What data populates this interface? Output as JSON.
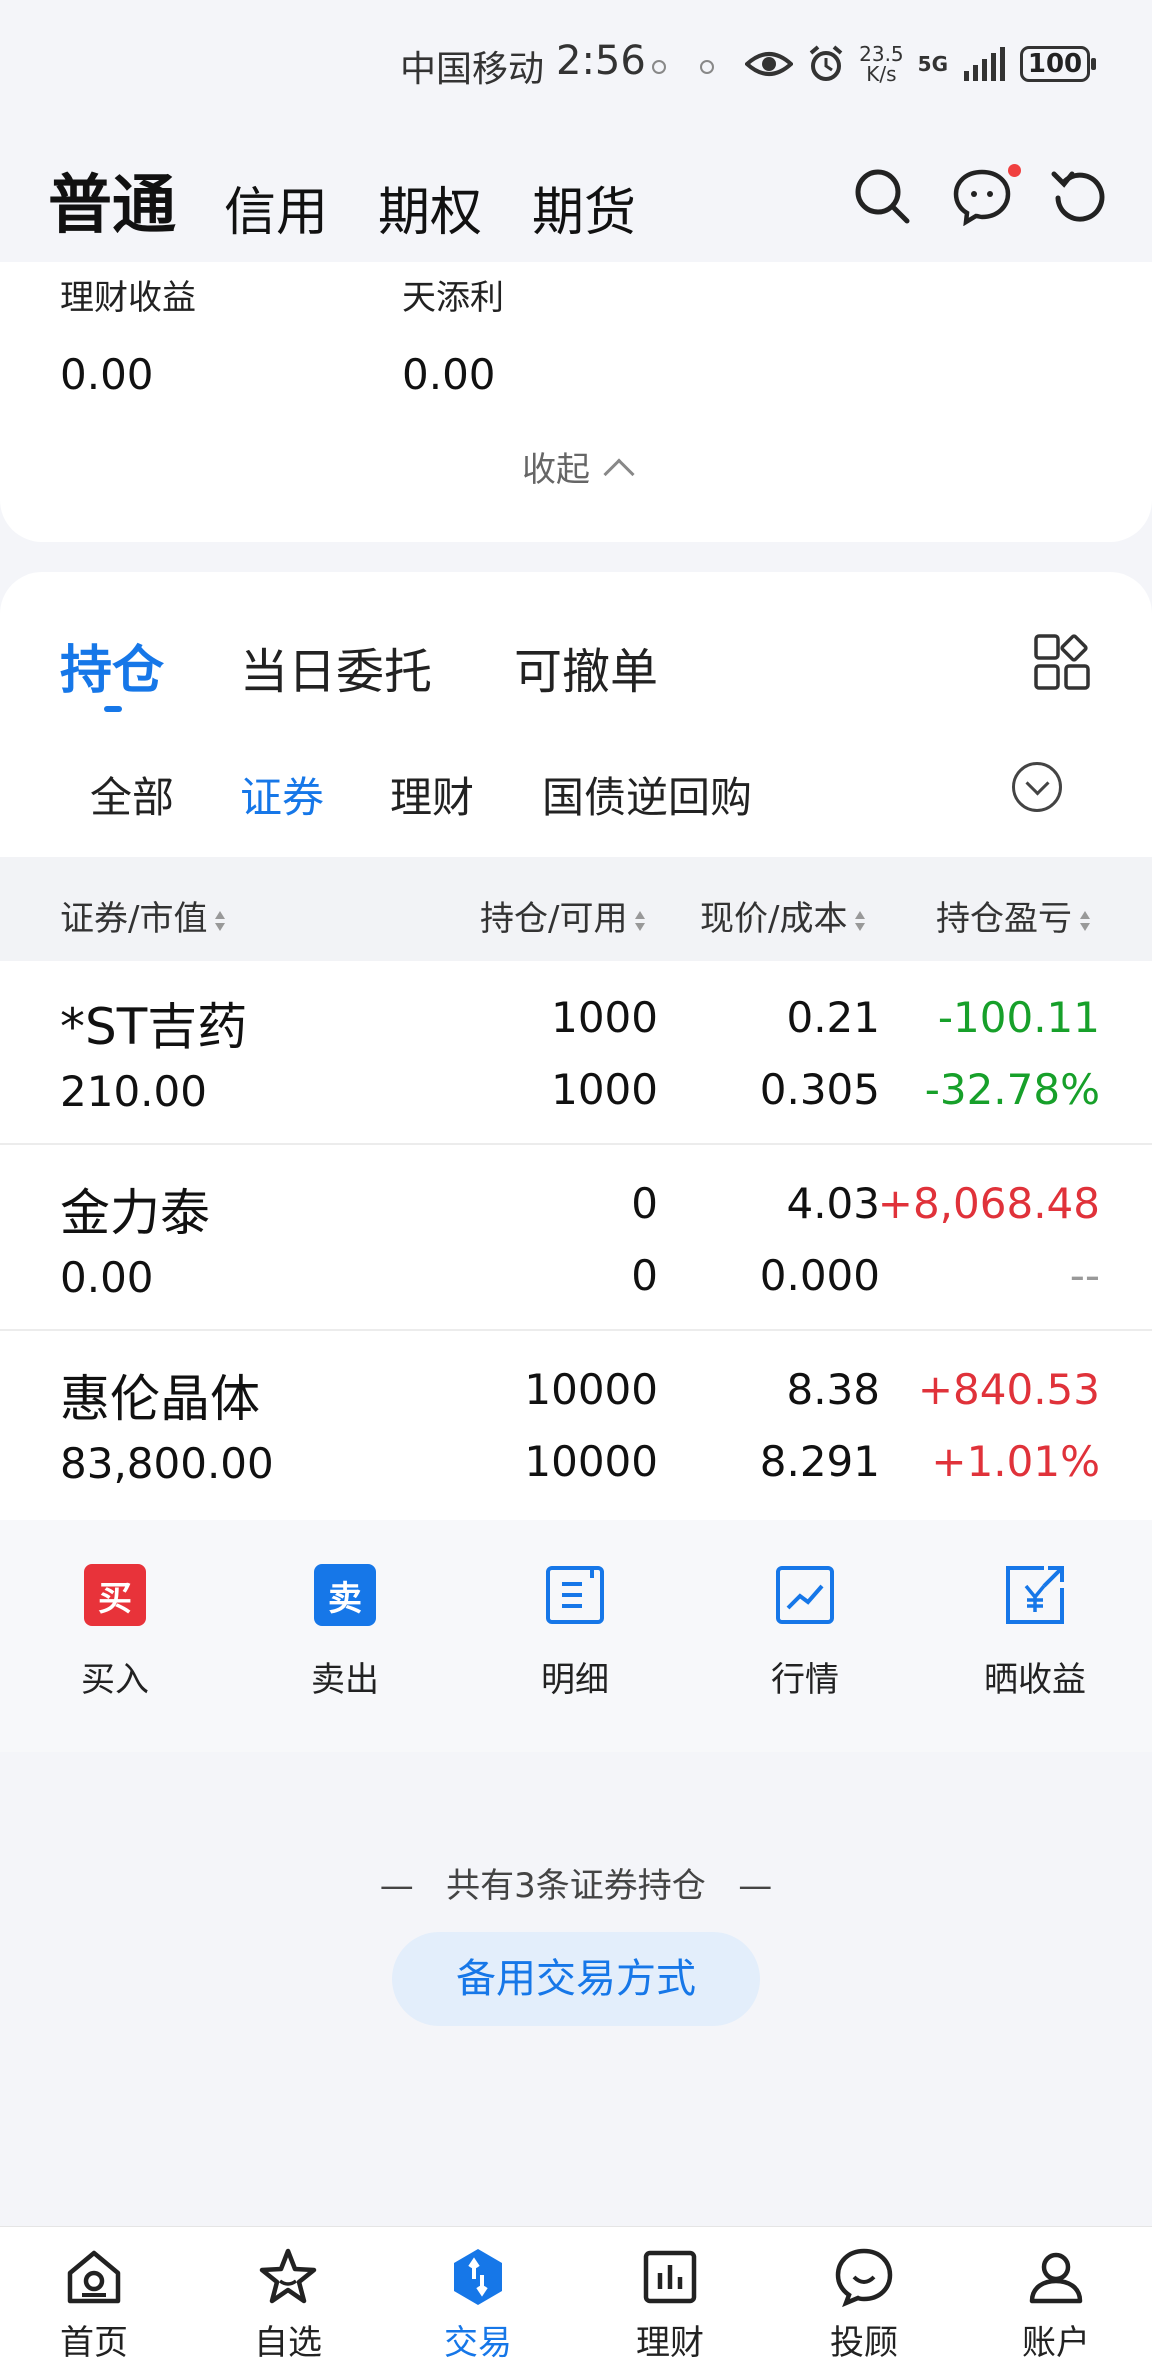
{
  "status_bar": {
    "carrier": "中国移动",
    "time": "2:56",
    "speed_value": "23.5",
    "speed_unit": "K/s",
    "network": "5G",
    "battery": "100"
  },
  "header": {
    "tabs": [
      "普通",
      "信用",
      "期权",
      "期货"
    ]
  },
  "summary": {
    "items": [
      {
        "label": "理财收益",
        "value": "0.00"
      },
      {
        "label": "天添利",
        "value": "0.00"
      }
    ],
    "collapse_label": "收起"
  },
  "positions": {
    "tabs": [
      "持仓",
      "当日委托",
      "可撤单"
    ],
    "sub_tabs": [
      "全部",
      "证券",
      "理财",
      "国债逆回购"
    ],
    "columns": [
      "证券/市值",
      "持仓/可用",
      "现价/成本",
      "持仓盈亏"
    ],
    "rows": [
      {
        "name": "*ST吉药",
        "market_value": "210.00",
        "holding": "1000",
        "available": "1000",
        "price": "0.21",
        "cost": "0.305",
        "pnl": "-100.11",
        "pnl_pct": "-32.78%"
      },
      {
        "name": "金力泰",
        "market_value": "0.00",
        "holding": "0",
        "available": "0",
        "price": "4.03",
        "cost": "0.000",
        "pnl": "+8,068.48",
        "pnl_pct": "--"
      },
      {
        "name": "惠伦晶体",
        "market_value": "83,800.00",
        "holding": "10000",
        "available": "10000",
        "price": "8.38",
        "cost": "8.291",
        "pnl": "+840.53",
        "pnl_pct": "+1.01%"
      }
    ]
  },
  "actions": [
    {
      "label": "买入",
      "glyph": "买",
      "color": "#e8333a"
    },
    {
      "label": "卖出",
      "glyph": "卖",
      "color": "#1677e8"
    },
    {
      "label": "明细",
      "icon": "list-icon"
    },
    {
      "label": "行情",
      "icon": "chart-icon"
    },
    {
      "label": "晒收益",
      "icon": "share-yuan-icon"
    }
  ],
  "footer": {
    "count_text": "共有3条证券持仓",
    "backup_button": "备用交易方式"
  },
  "nav": [
    "首页",
    "自选",
    "交易",
    "理财",
    "投顾",
    "账户"
  ],
  "colors": {
    "accent": "#1677e8",
    "up": "#e0323a",
    "down": "#17a02a"
  }
}
